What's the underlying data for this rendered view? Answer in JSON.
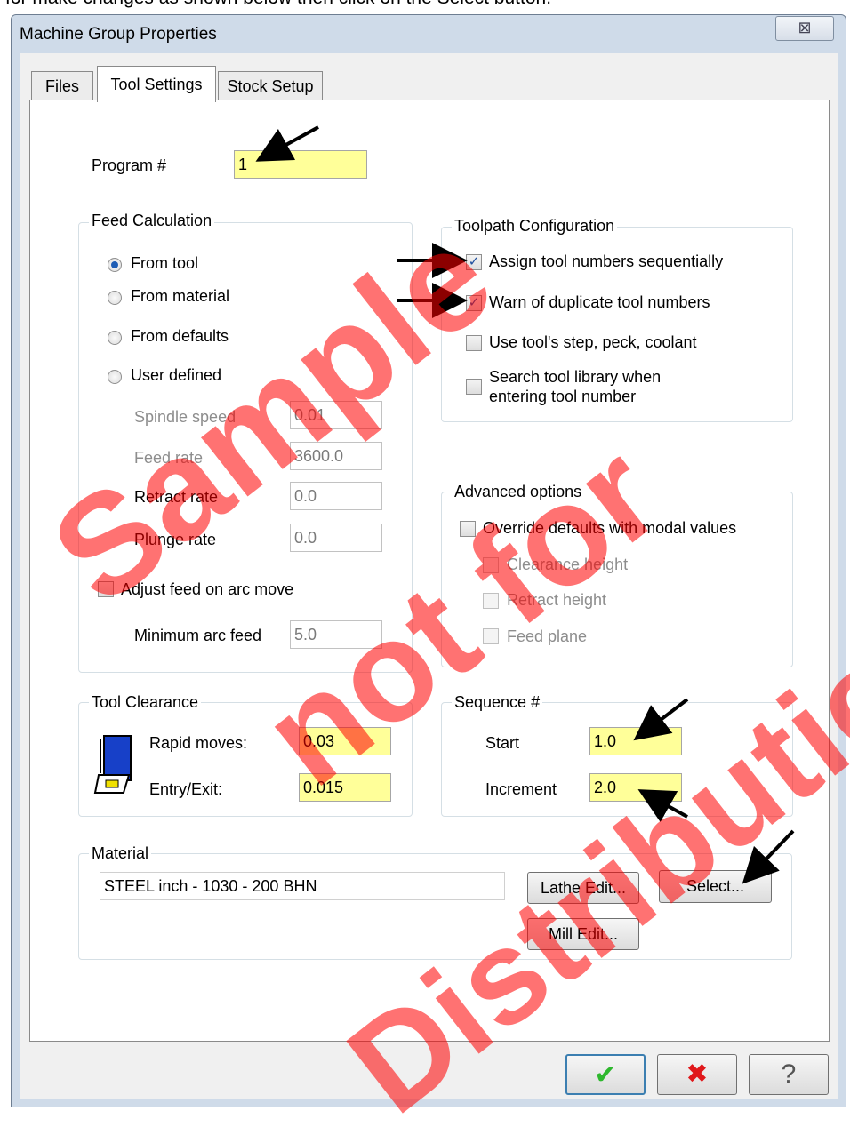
{
  "instruction": "for make changes as shown below then click on the Select button.",
  "window": {
    "title": "Machine Group Properties",
    "close_glyph": "⊠"
  },
  "tabs": [
    "Files",
    "Tool Settings",
    "Stock Setup"
  ],
  "program": {
    "label": "Program #",
    "value": "1"
  },
  "feed_calc": {
    "title": "Feed Calculation",
    "options": [
      "From tool",
      "From material",
      "From defaults",
      "User defined"
    ],
    "selected": "From tool",
    "spindle_speed": {
      "label": "Spindle speed",
      "value": "0.01"
    },
    "feed_rate": {
      "label": "Feed rate",
      "value": "3600.0"
    },
    "retract_rate": {
      "label": "Retract rate",
      "value": "0.0"
    },
    "plunge_rate": {
      "label": "Plunge rate",
      "value": "0.0"
    },
    "adjust_arc": {
      "label": "Adjust feed on arc move",
      "checked": false
    },
    "min_arc_feed": {
      "label": "Minimum arc feed",
      "value": "5.0"
    }
  },
  "toolpath": {
    "title": "Toolpath Configuration",
    "assign_seq": {
      "label": "Assign tool numbers sequentially",
      "checked": true
    },
    "warn_dup": {
      "label": "Warn of duplicate tool numbers",
      "checked": true
    },
    "use_step": {
      "label": "Use tool's step, peck, coolant",
      "checked": false
    },
    "search_lib_1": "Search tool library when",
    "search_lib_2": "entering tool number"
  },
  "advanced": {
    "title": "Advanced options",
    "override": "Override defaults with modal values",
    "clearance": "Clearance height",
    "retract": "Retract height",
    "feed_plane": "Feed plane"
  },
  "clearance": {
    "title": "Tool Clearance",
    "rapid": {
      "label": "Rapid moves:",
      "value": "0.03"
    },
    "entry": {
      "label": "Entry/Exit:",
      "value": "0.015"
    }
  },
  "sequence": {
    "title": "Sequence #",
    "start": {
      "label": "Start",
      "value": "1.0"
    },
    "increment": {
      "label": "Increment",
      "value": "2.0"
    }
  },
  "material": {
    "title": "Material",
    "value": "STEEL inch - 1030 - 200 BHN",
    "lathe_edit": "Lathe Edit...",
    "select": "Select...",
    "mill_edit": "Mill Edit..."
  },
  "footer": {
    "ok_glyph": "✔",
    "cancel_glyph": "✖",
    "help_glyph": "?"
  },
  "watermark": [
    "Sample",
    "not for",
    "Distribution"
  ],
  "colors": {
    "highlight": "#ffff99",
    "ok": "#2eb82e",
    "cancel": "#e0181b",
    "watermark": "#ff0000"
  }
}
